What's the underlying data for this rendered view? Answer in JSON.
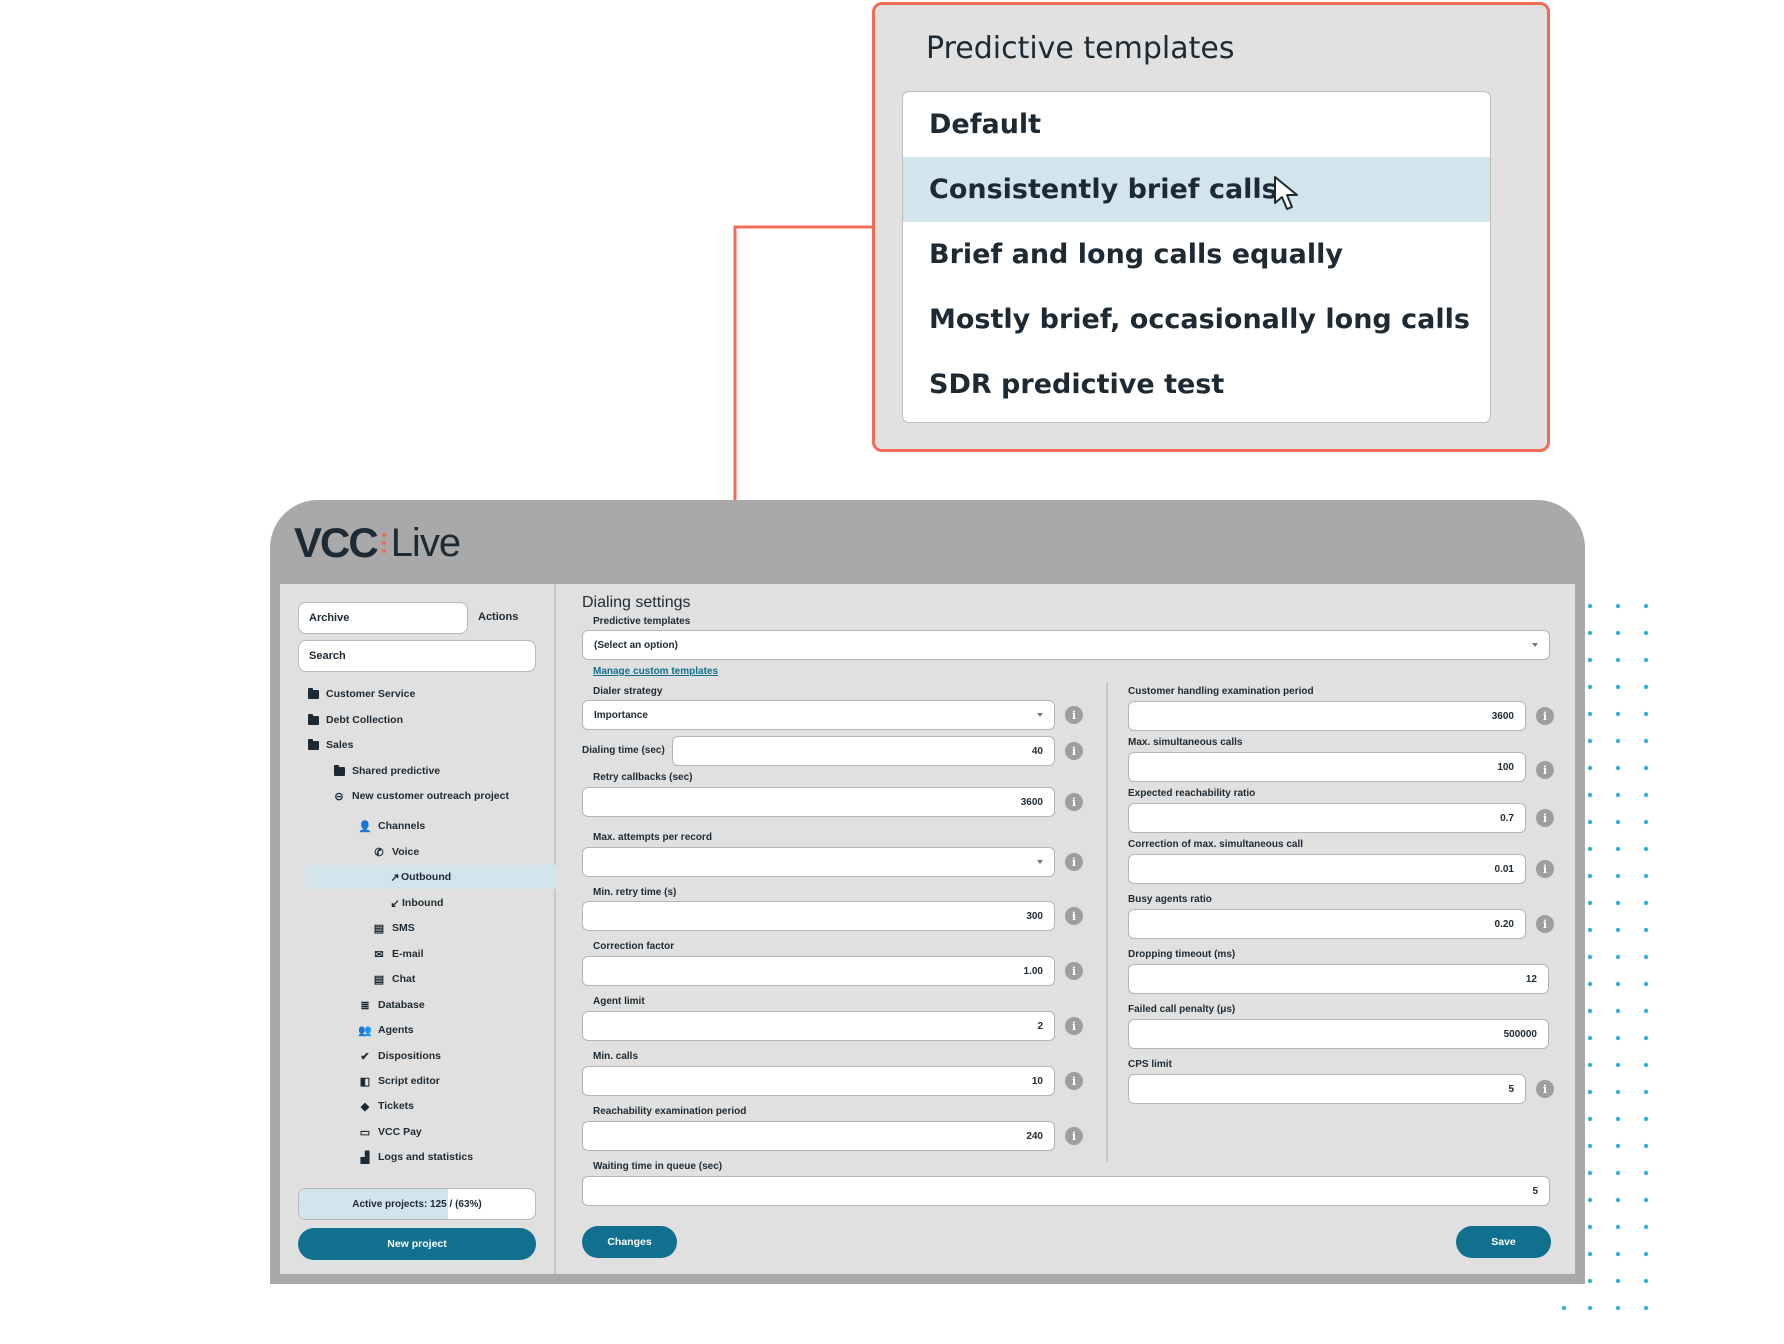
{
  "callout": {
    "title": "Predictive templates",
    "options": [
      {
        "label": "Default",
        "active": false
      },
      {
        "label": "Consistently brief calls",
        "active": true
      },
      {
        "label": "Brief and long calls equally",
        "active": false
      },
      {
        "label": "Mostly brief, occasionally long calls",
        "active": false
      },
      {
        "label": "SDR predictive test",
        "active": false
      }
    ]
  },
  "logo": {
    "part1": "VCC",
    "part2": "Live"
  },
  "colors": {
    "accent": "#12708f",
    "highlight": "#f06c56",
    "selected": "#d2e4ec"
  },
  "sidebar": {
    "archive": "Archive",
    "actions": "Actions",
    "search_placeholder": "Search",
    "tree": [
      {
        "label": "Customer Service",
        "icon": "folder-icon"
      },
      {
        "label": "Debt Collection",
        "icon": "folder-icon"
      },
      {
        "label": "Sales",
        "icon": "folder-icon"
      },
      {
        "label": "Shared predictive",
        "icon": "folder-icon"
      },
      {
        "label": "New customer outreach project",
        "icon": "project-icon"
      },
      {
        "label": "Channels",
        "icon": "person-icon"
      },
      {
        "label": "Voice",
        "icon": "phone-icon"
      },
      {
        "label": "Outbound",
        "icon": "arrow-up-right-icon"
      },
      {
        "label": "Inbound",
        "icon": "arrow-down-left-icon"
      },
      {
        "label": "SMS",
        "icon": "sms-icon"
      },
      {
        "label": "E-mail",
        "icon": "mail-icon"
      },
      {
        "label": "Chat",
        "icon": "chat-icon"
      },
      {
        "label": "Database",
        "icon": "database-icon"
      },
      {
        "label": "Agents",
        "icon": "agents-icon"
      },
      {
        "label": "Dispositions",
        "icon": "check-icon"
      },
      {
        "label": "Script editor",
        "icon": "script-icon"
      },
      {
        "label": "Tickets",
        "icon": "ticket-icon"
      },
      {
        "label": "VCC Pay",
        "icon": "card-icon"
      },
      {
        "label": "Logs and statistics",
        "icon": "stats-icon"
      }
    ],
    "active_projects": {
      "label": "Active projects: 125 / (63%)",
      "ratio": 0.63
    },
    "new_project": "New project"
  },
  "main": {
    "title": "Dialing settings",
    "predictive_label": "Predictive templates",
    "predictive_value": "(Select an option)",
    "manage_link": "Manage custom templates",
    "left": {
      "dialer_strategy": {
        "label": "Dialer strategy",
        "value": "Importance"
      },
      "dialing_time": {
        "label": "Dialing time (sec)",
        "value": "40"
      },
      "retry_callbacks": {
        "label": "Retry callbacks (sec)",
        "value": "3600"
      },
      "max_attempts": {
        "label": "Max. attempts per record",
        "value": ""
      },
      "min_retry": {
        "label": "Min. retry time (s)",
        "value": "300"
      },
      "correction_factor": {
        "label": "Correction factor",
        "value": "1.00"
      },
      "agent_limit": {
        "label": "Agent limit",
        "value": "2"
      },
      "min_calls": {
        "label": "Min. calls",
        "value": "10"
      },
      "reachability_period": {
        "label": "Reachability examination period",
        "value": "240"
      }
    },
    "right": {
      "handling_period": {
        "label": "Customer handling examination period",
        "value": "3600"
      },
      "max_simultaneous": {
        "label": "Max. simultaneous calls",
        "value": "100"
      },
      "reachability_ratio": {
        "label": "Expected reachability ratio",
        "value": "0.7"
      },
      "correction_max": {
        "label": "Correction of max. simultaneous call",
        "value": "0.01"
      },
      "busy_ratio": {
        "label": "Busy agents ratio",
        "value": "0.20"
      },
      "dropping_timeout": {
        "label": "Dropping timeout (ms)",
        "value": "12"
      },
      "failed_penalty": {
        "label": "Failed call penalty (μs)",
        "value": "500000"
      },
      "cps_limit": {
        "label": "CPS limit",
        "value": "5"
      }
    },
    "waiting_time": {
      "label": "Waiting time in queue (sec)",
      "value": "5"
    },
    "changes_button": "Changes",
    "save_button": "Save",
    "info_glyph": "i"
  }
}
